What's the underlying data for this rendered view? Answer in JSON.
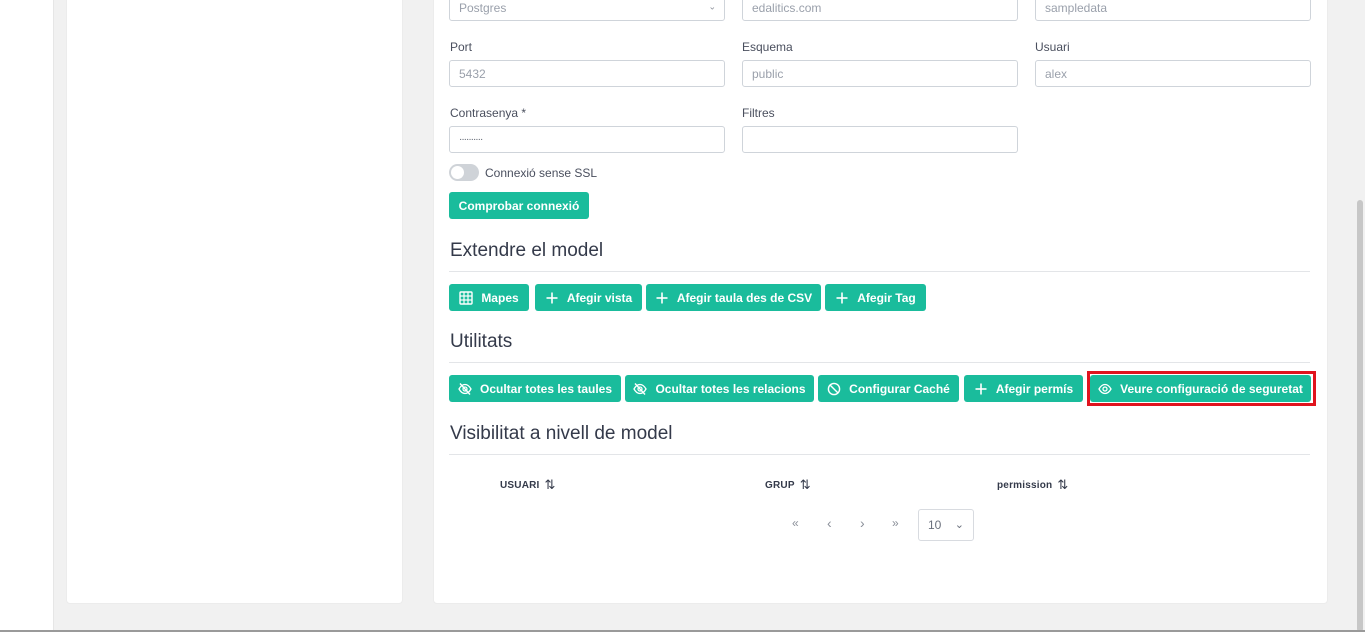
{
  "form": {
    "db_type_value": "Postgres",
    "host_value": "edalitics.com",
    "database_value": "sampledata",
    "port_label": "Port",
    "port_value": "5432",
    "schema_label": "Esquema",
    "schema_value": "public",
    "user_label": "Usuari",
    "user_value": "alex",
    "password_label": "Contrasenya *",
    "password_value": "··········",
    "filters_label": "Filtres",
    "filters_value": "",
    "ssl_toggle_label": "Connexió sense SSL",
    "test_connection_label": "Comprobar connexió"
  },
  "extend_model": {
    "title": "Extendre el model",
    "buttons": {
      "maps": "Mapes",
      "add_view": "Afegir vista",
      "add_csv_table": "Afegir taula des de CSV",
      "add_tag": "Afegir Tag"
    }
  },
  "utilities": {
    "title": "Utilitats",
    "buttons": {
      "hide_tables": "Ocultar totes les taules",
      "hide_relations": "Ocultar totes les relacions",
      "configure_cache": "Configurar Caché",
      "add_permission": "Afegir permís",
      "view_security": "Veure configuració de seguretat"
    }
  },
  "visibility": {
    "title": "Visibilitat a nivell de model",
    "columns": [
      "USUARI",
      "GRUP",
      "permission"
    ],
    "pager": {
      "first": "«",
      "prev": "‹",
      "next": "›",
      "last": "»",
      "page_size": "10"
    }
  },
  "colors": {
    "accent": "#1abc9c",
    "highlight": "#e0141e"
  }
}
